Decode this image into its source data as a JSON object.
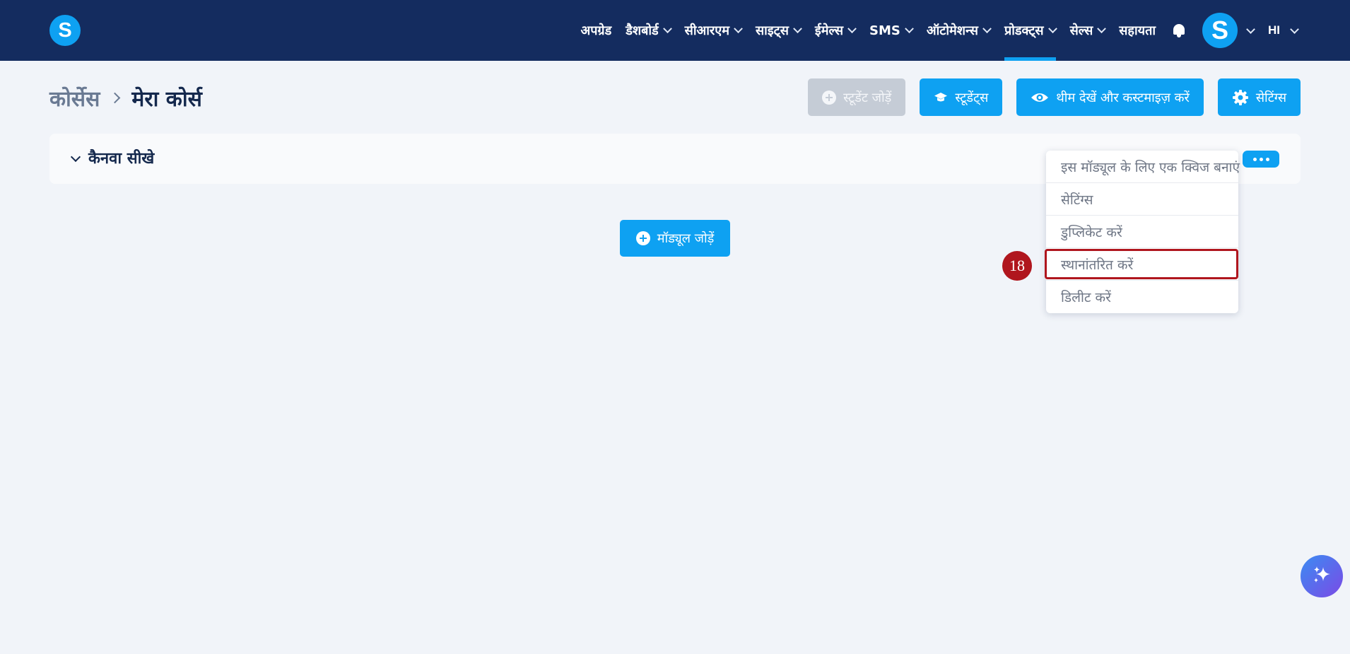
{
  "header": {
    "logo_letter": "S",
    "nav_items": [
      {
        "label": "अपग्रेड",
        "has_menu": false,
        "active": false
      },
      {
        "label": "डैशबोर्ड",
        "has_menu": true,
        "active": false
      },
      {
        "label": "सीआरएम",
        "has_menu": true,
        "active": false
      },
      {
        "label": "साइट्स",
        "has_menu": true,
        "active": false
      },
      {
        "label": "ईमेल्स",
        "has_menu": true,
        "active": false
      },
      {
        "label": "SMS",
        "has_menu": true,
        "active": false
      },
      {
        "label": "ऑटोमेशन्स",
        "has_menu": true,
        "active": false
      },
      {
        "label": "प्रोडक्ट्स",
        "has_menu": true,
        "active": true
      },
      {
        "label": "सेल्स",
        "has_menu": true,
        "active": false
      },
      {
        "label": "सहायता",
        "has_menu": false,
        "active": false
      }
    ],
    "avatar_letter": "S",
    "language": "HI"
  },
  "breadcrumb": {
    "parent": "कोर्सेस",
    "current": "मेरा कोर्स"
  },
  "actions": {
    "add_student": "स्टूडेंट जोड़ें",
    "students": "स्टूडेंट्स",
    "theme": "थीम देखें और कस्टमाइज़ करें",
    "settings": "सेटिंग्स"
  },
  "module": {
    "title": "कैनवा सीखे"
  },
  "dropdown": {
    "items": [
      "इस मॉड्यूल के लिए एक क्विज बनाएं",
      "सेटिंग्स",
      "डुप्लिकेट करें",
      "स्थानांतरित करें",
      "डिलीट करें"
    ]
  },
  "add_module": "मॉड्यूल जोड़ें",
  "marker": "18",
  "colors": {
    "nav_bg": "#142c5f",
    "accent": "#0ea1f2",
    "highlight": "#b0161e"
  }
}
